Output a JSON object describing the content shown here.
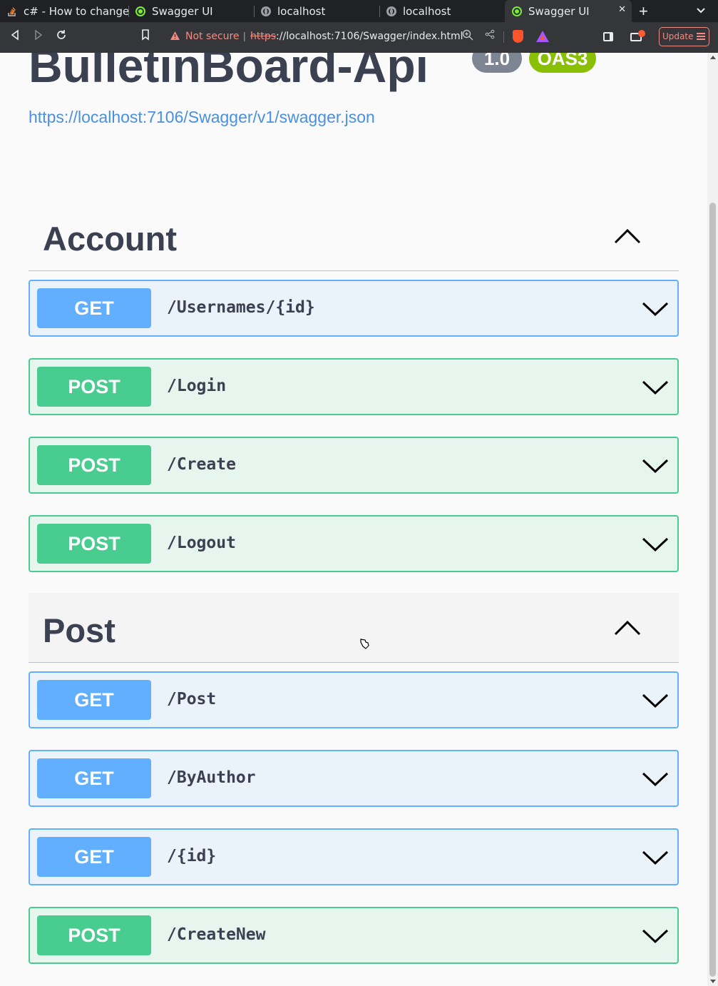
{
  "browser": {
    "tabs": [
      {
        "title": "c# - How to change",
        "icon": "stackoverflow-icon",
        "active": false
      },
      {
        "title": "Swagger UI",
        "icon": "swagger-icon",
        "active": false
      },
      {
        "title": "localhost",
        "icon": "globe-icon",
        "active": false
      },
      {
        "title": "localhost",
        "icon": "globe-icon",
        "active": false
      },
      {
        "title": "Swagger UI",
        "icon": "swagger-icon",
        "active": true
      }
    ],
    "new_tab": "+",
    "security_label": "Not secure",
    "url_scheme": "https",
    "url_rest": "://localhost:7106/Swagger/index.html",
    "update_label": "Update"
  },
  "info": {
    "title": "BulletinBoard-Api",
    "version": "1.0",
    "oas": "OAS3",
    "spec_url": "https://localhost:7106/Swagger/v1/swagger.json"
  },
  "tags": [
    {
      "name": "Account",
      "operations": [
        {
          "method": "GET",
          "path": "/Usernames/{id}"
        },
        {
          "method": "POST",
          "path": "/Login"
        },
        {
          "method": "POST",
          "path": "/Create"
        },
        {
          "method": "POST",
          "path": "/Logout"
        }
      ]
    },
    {
      "name": "Post",
      "operations": [
        {
          "method": "GET",
          "path": "/Post"
        },
        {
          "method": "GET",
          "path": "/ByAuthor"
        },
        {
          "method": "GET",
          "path": "/{id}"
        },
        {
          "method": "POST",
          "path": "/CreateNew"
        }
      ]
    }
  ],
  "colors": {
    "get": "#61affe",
    "post": "#49cc90",
    "title": "#3b4151",
    "link": "#4990e2",
    "version_badge": "#7d8492",
    "oas_badge": "#89bf04"
  }
}
